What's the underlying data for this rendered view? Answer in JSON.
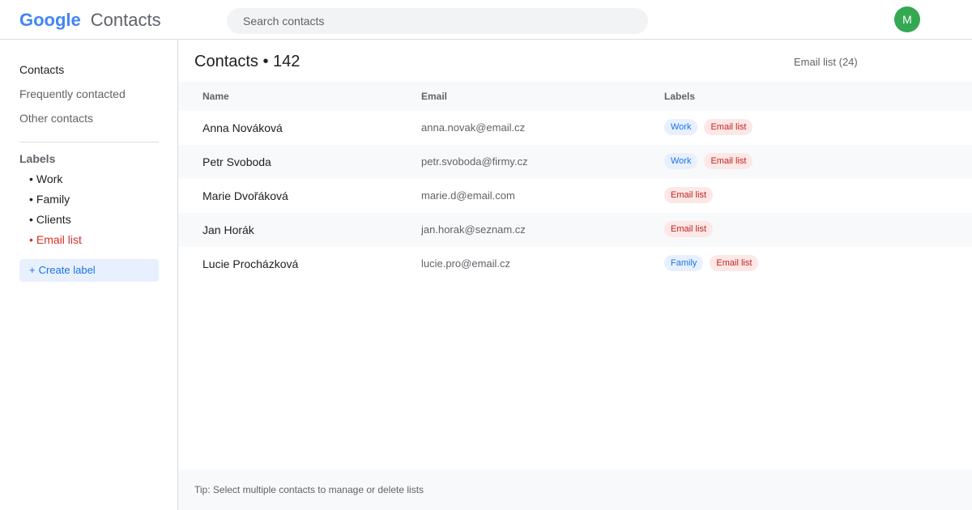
{
  "header": {
    "logo_google": "Google",
    "logo_product": "Contacts",
    "search_placeholder": "Search contacts",
    "avatar_initial": "M"
  },
  "sidebar": {
    "nav": [
      {
        "label": "Contacts",
        "active": true
      },
      {
        "label": "Frequently contacted",
        "active": false
      },
      {
        "label": "Other contacts",
        "active": false
      }
    ],
    "labels_heading": "Labels",
    "labels": [
      {
        "bullet": "•",
        "label": "Work",
        "selected": false
      },
      {
        "bullet": "•",
        "label": "Family",
        "selected": false
      },
      {
        "bullet": "•",
        "label": "Clients",
        "selected": false
      },
      {
        "bullet": "•",
        "label": "Email list",
        "selected": true
      }
    ],
    "create_label": {
      "icon": "+",
      "label": "Create label"
    }
  },
  "main": {
    "title": "Contacts • 142",
    "filter_badge": "Email list (24)",
    "table": {
      "columns": {
        "name": "Name",
        "email": "Email",
        "labels": "Labels"
      },
      "rows": [
        {
          "name": "Anna Nováková",
          "email": "anna.novak@email.cz",
          "labels": [
            "Work",
            "Email list"
          ]
        },
        {
          "name": "Petr Svoboda",
          "email": "petr.svoboda@firmy.cz",
          "labels": [
            "Work",
            "Email list"
          ]
        },
        {
          "name": "Marie Dvořáková",
          "email": "marie.d@email.com",
          "labels": [
            "Email list"
          ]
        },
        {
          "name": "Jan Horák",
          "email": "jan.horak@seznam.cz",
          "labels": [
            "Email list"
          ]
        },
        {
          "name": "Lucie Procházková",
          "email": "lucie.pro@email.cz",
          "labels": [
            "Family",
            "Email list"
          ]
        }
      ]
    },
    "footer_tip": "Tip: Select multiple contacts to manage or delete lists"
  },
  "colors": {
    "brand_blue": "#4285f4",
    "accent_blue": "#1a73e8",
    "email_list_red": "#d93025",
    "avatar_green": "#34a853"
  }
}
